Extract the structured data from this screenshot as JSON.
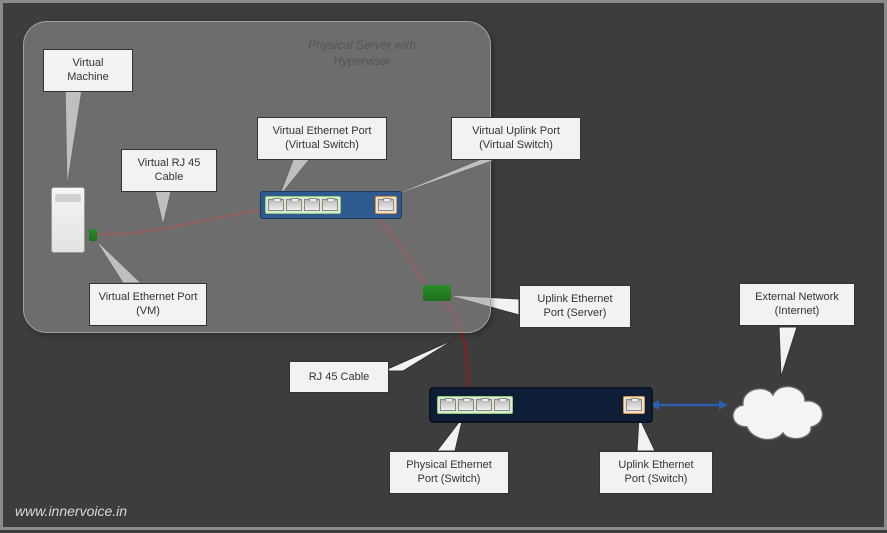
{
  "hypervisor_title": "Physical Server with Hypervisor",
  "labels": {
    "vm": "Virtual Machine",
    "v_rj45": "Virtual RJ 45 Cable",
    "v_eth_vm": "Virtual Ethernet Port (VM)",
    "v_eth_vswitch": "Virtual Ethernet Port (Virtual Switch)",
    "v_uplink_vswitch": "Virtual Uplink Port (Virtual Switch)",
    "uplink_eth_server": "Uplink Ethernet Port (Server)",
    "rj45": "RJ 45 Cable",
    "phys_eth_switch": "Physical Ethernet Port (Switch)",
    "uplink_eth_switch": "Uplink Ethernet Port (Switch)",
    "external": "External Network (Internet)"
  },
  "watermark": "www.innervoice.in"
}
